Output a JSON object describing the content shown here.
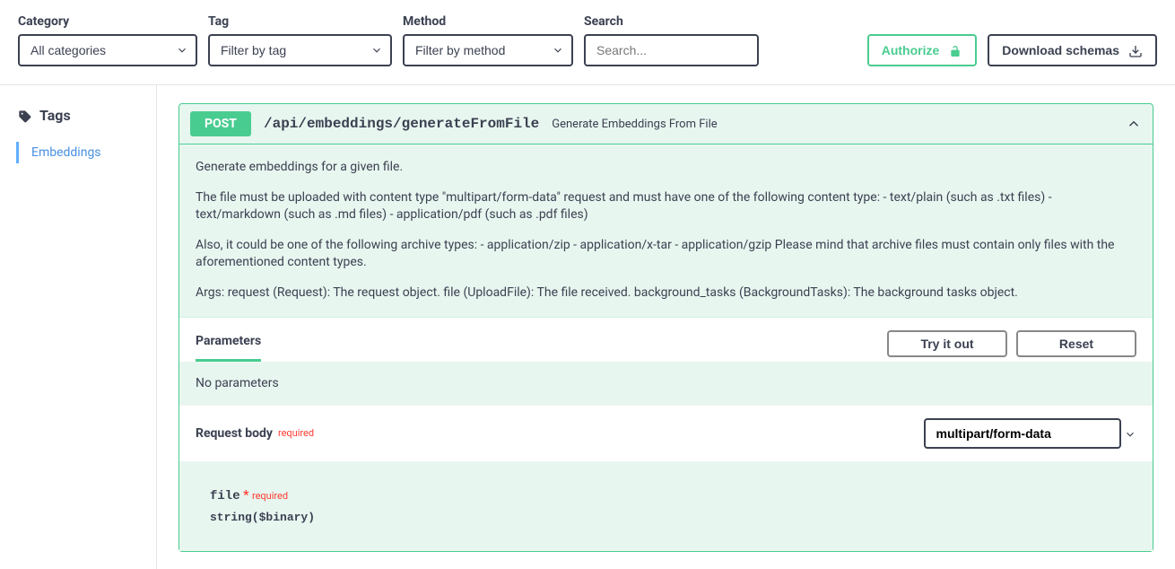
{
  "filters": {
    "category": {
      "label": "Category",
      "value": "All categories"
    },
    "tag": {
      "label": "Tag",
      "value": "Filter by tag"
    },
    "method": {
      "label": "Method",
      "value": "Filter by method"
    },
    "search": {
      "label": "Search",
      "placeholder": "Search..."
    }
  },
  "actions": {
    "authorize": "Authorize",
    "download": "Download schemas"
  },
  "sidebar": {
    "heading": "Tags",
    "items": [
      {
        "label": "Embeddings"
      }
    ]
  },
  "operation": {
    "method": "POST",
    "path": "/api/embeddings/generateFromFile",
    "summary": "Generate Embeddings From File",
    "desc": {
      "p1": "Generate embeddings for a given file.",
      "p2": "The file must be uploaded with content type \"multipart/form-data\" request and must have one of the following content type: - text/plain (such as .txt files) - text/markdown (such as .md files) - application/pdf (such as .pdf files)",
      "p3": "Also, it could be one of the following archive types: - application/zip - application/x-tar - application/gzip Please mind that archive files must contain only files with the aforementioned content types.",
      "p4": "Args: request (Request): The request object. file (UploadFile): The file received. background_tasks (BackgroundTasks): The background tasks object."
    },
    "tabs": {
      "parameters": "Parameters",
      "tryit": "Try it out",
      "reset": "Reset"
    },
    "no_params": "No parameters",
    "request_body": {
      "title": "Request body",
      "required_label": "required",
      "content_type": "multipart/form-data",
      "param": {
        "name": "file",
        "required_label": "required",
        "type": "string($binary)"
      }
    }
  }
}
